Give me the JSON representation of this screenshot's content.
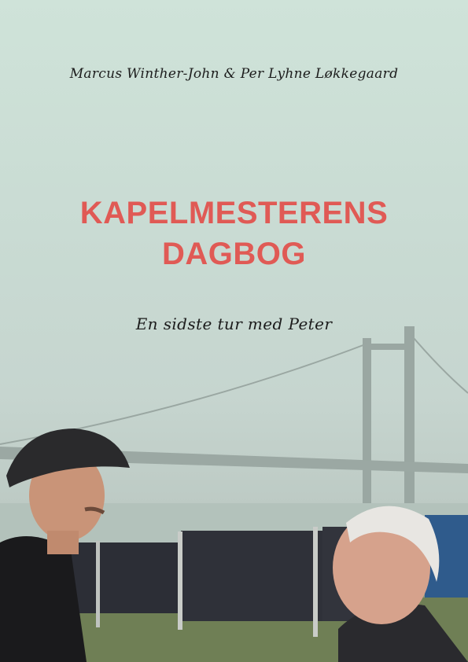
{
  "cover": {
    "authors": "Marcus Winther-John & Per Lyhne Løkkegaard",
    "title_line1": "KAPELMESTERENS",
    "title_line2": "DAGBOG",
    "subtitle": "En sidste tur med Peter"
  },
  "colors": {
    "title": "#e05a55",
    "sky": "#cfe3d9",
    "script_text": "#1c1c1c"
  }
}
